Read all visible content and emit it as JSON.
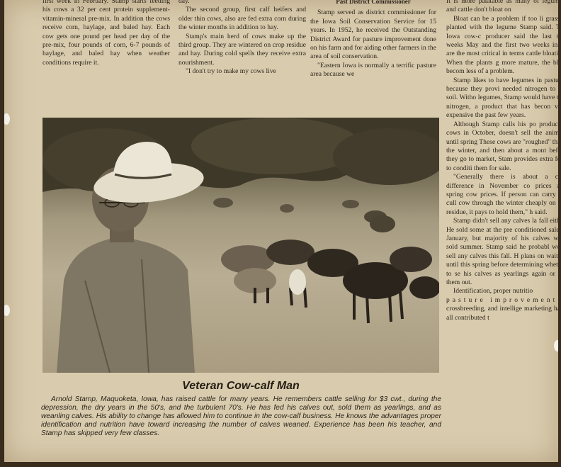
{
  "col1": {
    "paragraphs": [
      "first week in February. Stamp starts feeding his cows a 32 per cent protein supplement-vitamin-mineral pre-mix. In addition the cows receive corn, haylage, and baled hay. Each cow gets one pound per head per day of the pre-mix, four pounds of corn, 6-7 pounds of haylage, and baled hay when weather conditions require it."
    ]
  },
  "col2": {
    "top_word": "day.",
    "paragraphs": [
      "The second group, first calf heifers and older thin cows, also are fed extra corn during the winter months in addition to hay.",
      "Stamp's main herd of cows make up the third group. They are wintered on crop residue and hay. During cold spells they receive extra nourishment.",
      "\"I don't try to make my cows live"
    ]
  },
  "col3": {
    "heading": "Past District Commissioner",
    "paragraphs": [
      "Stamp served as district commissioner for the Iowa Soil Conservation Service for 15 years. In 1952, he received the Outstanding District Award for pasture improvement done on his farm and for aiding other farmers in the area of soil conservation.",
      "\"Eastern Iowa is normally a terrific pasture area because we"
    ]
  },
  "col4": {
    "paragraphs": [
      "It is more palatable as many of legumes, and cattle don't bloat on",
      "Bloat can be a problem if too li grass is planted with the legume Stamp said. The Iowa cow-c producer said the last two weeks May and the first two weeks in Ju are the most critical in terms cattle bloating. When the plants g more mature, the bloat becom less of a problem.",
      "Stamp likes to have legumes in pastures because they provi needed nitrogen to the soil. Witho legumes, Stamp would have to a nitrogen, a product that has becon very expensive the past few years.",
      "Although Stamp calls his po producing cows in October, doesn't sell the animals until spring These cows are \"roughed\" throu the winter, and then about a mont before they go to market, Stam provides extra feed to conditi them for sale.",
      "\"Generally there is about a cwt. difference in November co prices and spring cow prices. If person can carry his cull cow through the winter cheaply on cro residue, it pays to hold them,\" h said.",
      "Stamp didn't sell any calves la fall either. He sold some at the pre conditioned sale in January, but majority of his calves were sold summer. Stamp said he probabl won't sell any calves this fall. H plans on waiting until this spring before determining whether to se his calves as yearlings again or fee them out.",
      "Identification, proper nutritio"
    ],
    "spaced_line": "pasture improvement",
    "tail": "crossbreeding, and intellige marketing have all contributed t"
  },
  "caption": {
    "title": "Veteran Cow-calf Man",
    "text": "Arnold Stamp, Maquoketa, Iowa, has raised cattle for many years. He remembers cattle selling for $3 cwt., during the depression, the dry years in the 50's, and the turbulent 70's. He has fed his calves out, sold them as yearlings, and as weanling calves. His ability to change has allowed him to continue in the cow-calf business. He knows the advantages proper identification and nutrition have toward increasing the number of calves weaned. Experience has been his teacher, and Stamp has skipped very few classes."
  }
}
